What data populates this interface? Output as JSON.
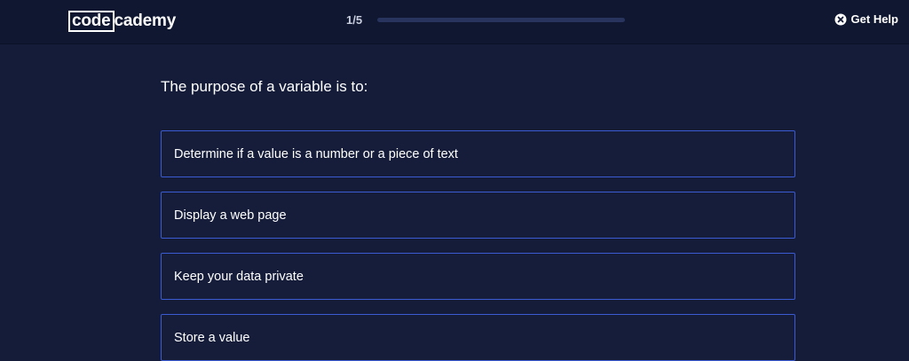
{
  "header": {
    "logo_part1": "code",
    "logo_part2": "cademy",
    "progress_text": "1/5",
    "progress_fraction": 0.0,
    "help_label": "Get Help",
    "help_icon": "close-circle-icon"
  },
  "quiz": {
    "question": "The purpose of a variable is to:",
    "options": [
      "Determine if a value is a number or a piece of text",
      "Display a web page",
      "Keep your data private",
      "Store a value"
    ]
  },
  "colors": {
    "background": "#141c3a",
    "header_background": "#101731",
    "option_border": "#3a5bd1",
    "progress_track": "#28345e"
  }
}
